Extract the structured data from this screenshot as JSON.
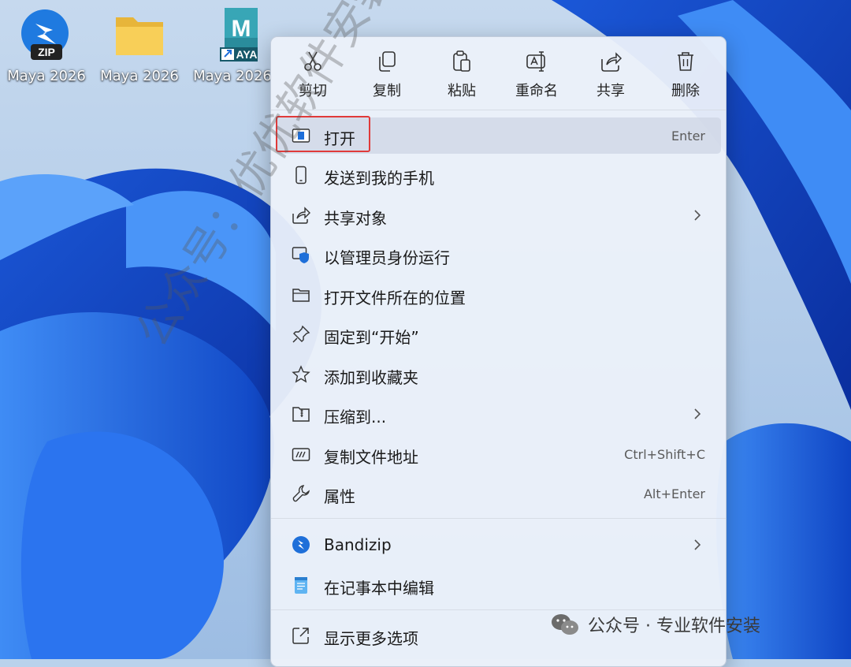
{
  "desktop": {
    "icons": [
      {
        "label": "Maya 2026",
        "icon": "bandizip-zip-icon",
        "badge": "ZIP"
      },
      {
        "label": "Maya 2026",
        "icon": "folder-icon"
      },
      {
        "label": "Maya 2026",
        "icon": "maya-shortcut-icon",
        "letter": "M",
        "badge": "AYA"
      }
    ]
  },
  "context_menu": {
    "toolbar": [
      {
        "label": "剪切",
        "icon": "scissors-icon"
      },
      {
        "label": "复制",
        "icon": "copy-icon"
      },
      {
        "label": "粘贴",
        "icon": "paste-icon"
      },
      {
        "label": "重命名",
        "icon": "rename-icon"
      },
      {
        "label": "共享",
        "icon": "share-icon"
      },
      {
        "label": "删除",
        "icon": "trash-icon"
      }
    ],
    "items": [
      {
        "label": "打开",
        "shortcut": "Enter",
        "icon": "open-window-icon",
        "highlighted": true
      },
      {
        "label": "发送到我的手机",
        "icon": "phone-icon"
      },
      {
        "label": "共享对象",
        "icon": "share-icon",
        "submenu": true
      },
      {
        "label": "以管理员身份运行",
        "icon": "shield-admin-icon"
      },
      {
        "label": "打开文件所在的位置",
        "icon": "folder-icon"
      },
      {
        "label": "固定到“开始”",
        "icon": "pin-icon"
      },
      {
        "label": "添加到收藏夹",
        "icon": "star-icon"
      },
      {
        "label": "压缩到...",
        "icon": "zip-folder-icon",
        "submenu": true
      },
      {
        "label": "复制文件地址",
        "shortcut": "Ctrl+Shift+C",
        "icon": "copy-path-icon"
      },
      {
        "label": "属性",
        "shortcut": "Alt+Enter",
        "icon": "wrench-icon"
      },
      {
        "label": "Bandizip",
        "icon": "bandizip-icon",
        "submenu": true
      },
      {
        "label": "在记事本中编辑",
        "icon": "notepad-icon"
      },
      {
        "label": "显示更多选项",
        "icon": "more-options-icon"
      }
    ]
  },
  "watermark": {
    "diagonal": "公众号：优优软件安装",
    "footer": "公众号 · 专业软件安装"
  },
  "colors": {
    "highlight_border": "#e03a3a",
    "accent_blue": "#1e6fd9"
  }
}
